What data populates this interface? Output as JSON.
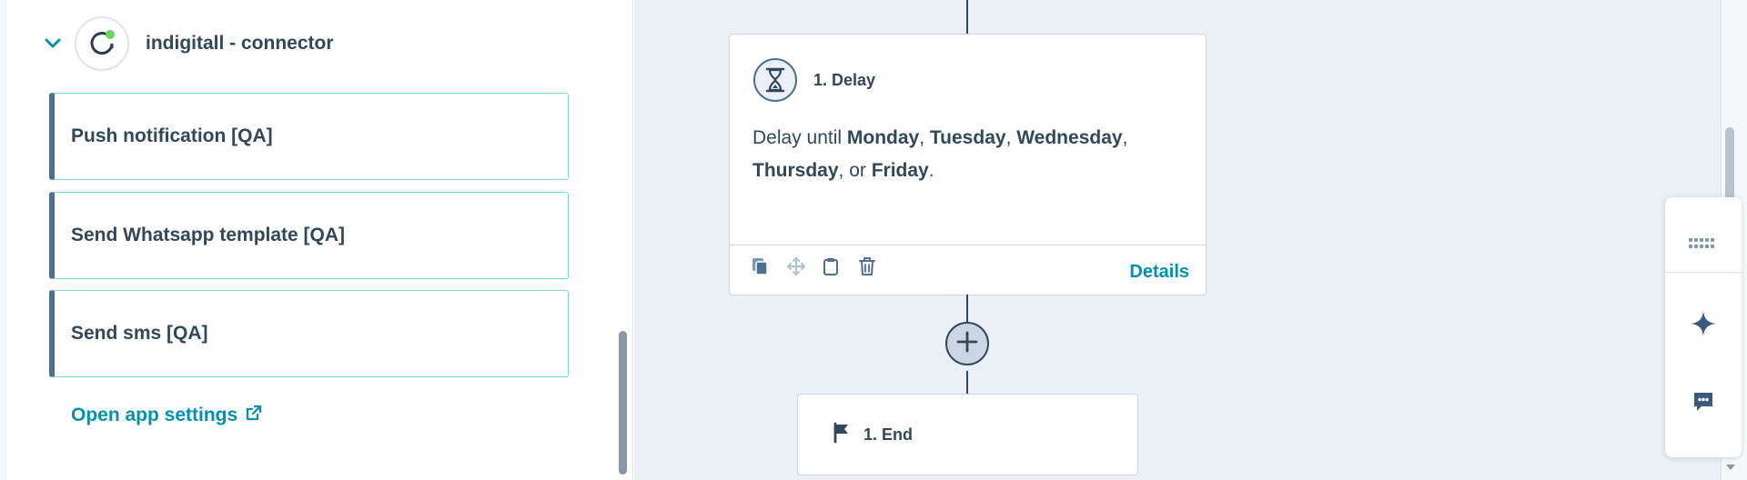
{
  "sidebar": {
    "app_name": "indigitall - connector",
    "actions": [
      {
        "label": "Push notification [QA]"
      },
      {
        "label": "Send Whatsapp template [QA]"
      },
      {
        "label": "Send sms [QA]"
      }
    ],
    "open_settings_label": "Open app settings"
  },
  "workflow": {
    "delay": {
      "title": "1. Delay",
      "prefix": "Delay until ",
      "days": [
        "Monday",
        "Tuesday",
        "Wednesday",
        "Thursday",
        "Friday"
      ],
      "sep_comma": ", ",
      "sep_or": ", or ",
      "suffix": ".",
      "details_label": "Details"
    },
    "end": {
      "title": "1. End"
    }
  },
  "colors": {
    "accent": "#0091ae",
    "text": "#33475b",
    "canvas": "#eaf0f6",
    "card_border": "#7fd1de",
    "status_dot": "#6bd45a"
  },
  "icons": {
    "collapse": "chevron-down-icon",
    "external": "external-link-icon",
    "delay": "hourglass-icon",
    "end": "flag-icon",
    "copy": "copy-icon",
    "move": "move-icon",
    "clipboard": "clipboard-icon",
    "delete": "trash-icon",
    "add": "plus-icon",
    "grid": "grid-icon",
    "ai": "sparkle-icon",
    "comments": "comment-icon"
  }
}
